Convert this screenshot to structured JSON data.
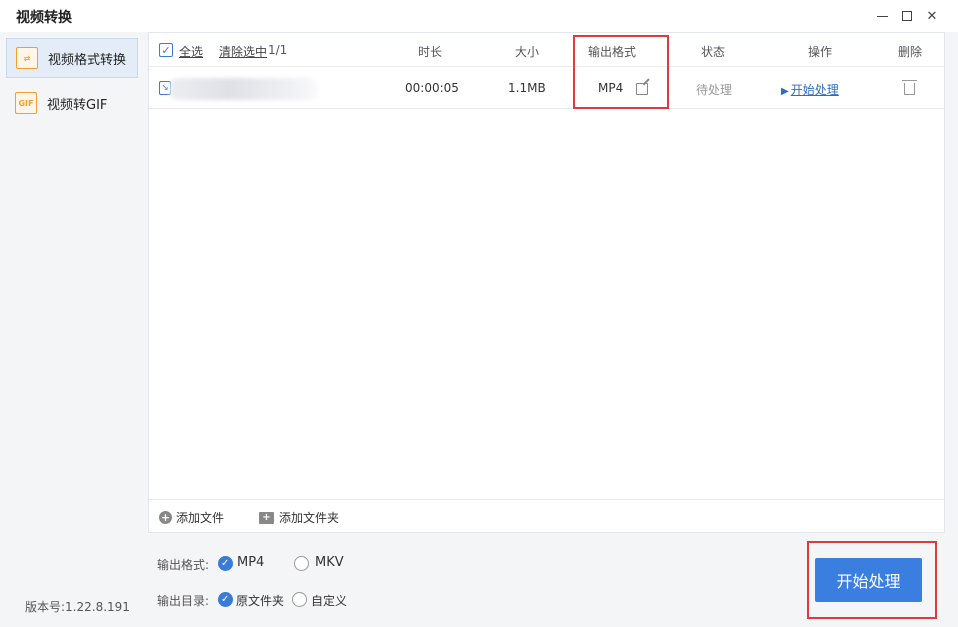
{
  "app": {
    "title": "视频转换"
  },
  "sidebar": {
    "items": [
      {
        "label": "视频格式转换",
        "icon": "video-convert-icon",
        "active": true
      },
      {
        "label": "视频转GIF",
        "icon": "gif-icon",
        "active": false
      }
    ],
    "gif_badge": "GIF",
    "version": "版本号:1.22.8.191"
  },
  "table": {
    "select_all": "全选",
    "clear_selected": "清除选中",
    "count": "1/1",
    "headers": {
      "duration": "时长",
      "size": "大小",
      "format": "输出格式",
      "status": "状态",
      "action": "操作",
      "delete": "删除"
    },
    "rows": [
      {
        "duration": "00:00:05",
        "size": "1.1MB",
        "format": "MP4",
        "status": "待处理",
        "action": "开始处理"
      }
    ]
  },
  "footer": {
    "add_file": "添加文件",
    "add_folder": "添加文件夹"
  },
  "options": {
    "format_label": "输出格式:",
    "format_options": [
      "MP4",
      "MKV"
    ],
    "format_selected": "MP4",
    "dir_label": "输出目录:",
    "dir_options": [
      "原文件夹",
      "自定义"
    ],
    "dir_selected": "原文件夹"
  },
  "start_button": "开始处理",
  "colors": {
    "accent": "#3a7fe0",
    "highlight_box": "#e03a3a",
    "icon_orange": "#f0a030"
  }
}
